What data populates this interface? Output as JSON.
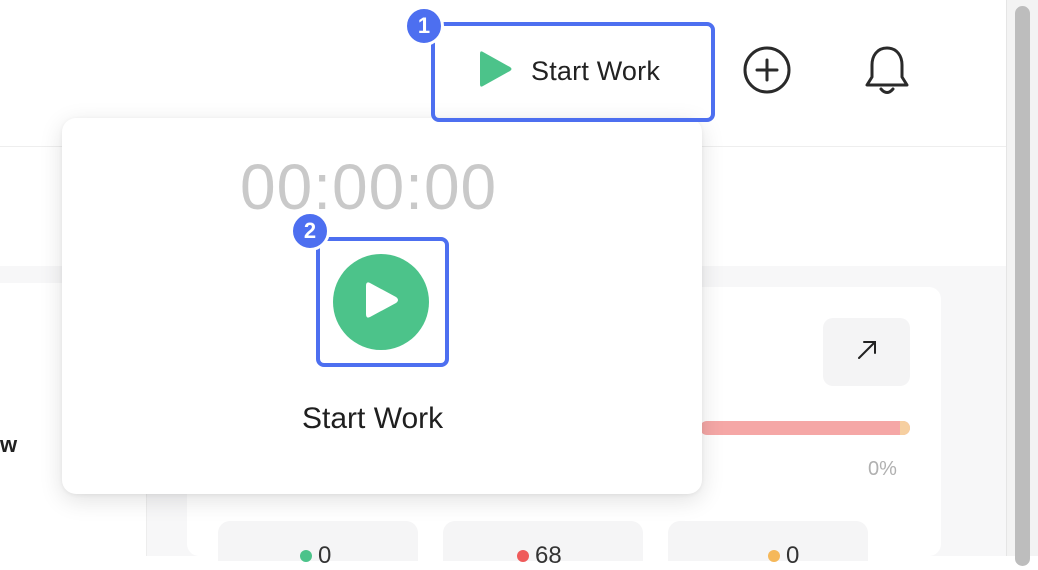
{
  "header": {
    "start_work_label": "Start Work",
    "add_icon": "plus-circle-icon",
    "bell_icon": "bell-icon",
    "play_icon": "play-icon"
  },
  "popover": {
    "timer": "00:00:00",
    "action_label": "Start Work",
    "play_icon": "play-icon"
  },
  "background": {
    "left_card_text": "w",
    "expand_icon": "arrow-up-right-icon",
    "progress_percent": "0%",
    "progress_value": 0,
    "stats": [
      {
        "value": "0",
        "color": "#4cc38a"
      },
      {
        "value": "68",
        "color": "#ef5b5b"
      },
      {
        "value": "0",
        "color": "#f5b85a"
      }
    ]
  },
  "annotations": {
    "marker_1": "1",
    "marker_2": "2"
  },
  "colors": {
    "accent_green": "#4cc38a",
    "highlight_blue": "#4d6ff0",
    "progress_red": "#f5a7a6"
  }
}
